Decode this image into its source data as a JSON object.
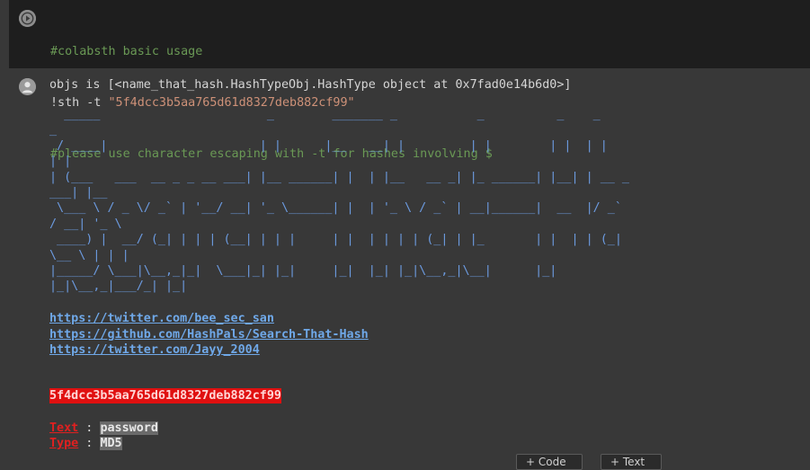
{
  "code_cell": {
    "lines": [
      {
        "type": "comment",
        "text": "#colabsth basic usage"
      },
      {
        "type": "command",
        "prefix": "!sth -t ",
        "string": "\"5f4dcc3b5aa765d61d8327deb882cf99\""
      },
      {
        "type": "comment",
        "text": "#please use character escaping with -t for hashes involving $"
      }
    ]
  },
  "output": {
    "objs_line": "objs is [<name_that_hash.HashTypeObj.HashType object at 0x7fad0e14b6d0>]",
    "ascii_banner": "  _____                       _        _______ _           _          _    _\n_\n / ____|                     | |      |__   __| |         | |        | |  | |\n| |\n| (___   ___  __ _ _ __ ___| |__ ______| |  | |__   __ _| |_ ______| |__| | __ _\n___| |__\n \\___ \\ / _ \\/ _` | '__/ __| '_ \\______| |  | '_ \\ / _` | __|______|  __  |/ _`\n/ __| '_ \\\n ____) |  __/ (_| | | | (__| | | |     | |  | | | | (_| | |_       | |  | | (_|\n\\__ \\ | | |\n|_____/ \\___|\\__,_|_|  \\___|_| |_|     |_|  |_| |_|\\__,_|\\__|      |_|\n|_|\\__,_|___/_| |_|",
    "links": [
      "https://twitter.com/bee_sec_san",
      "https://github.com/HashPals/Search-That-Hash",
      "https://twitter.com/Jayy_2004"
    ],
    "hash": "5f4dcc3b5aa765d61d8327deb882cf99",
    "results": [
      {
        "key": "Text",
        "sep": " : ",
        "value": "password"
      },
      {
        "key": "Type",
        "sep": " : ",
        "value": "MD5"
      }
    ]
  },
  "toolbar": {
    "add_code_label": "+ Code",
    "add_text_label": "+ Text"
  },
  "colors": {
    "comment": "#6a9955",
    "string": "#ce9178",
    "banner": "#6c9be0",
    "link": "#6fa8e8",
    "hash_bg": "#e01010",
    "key": "#e02020"
  }
}
